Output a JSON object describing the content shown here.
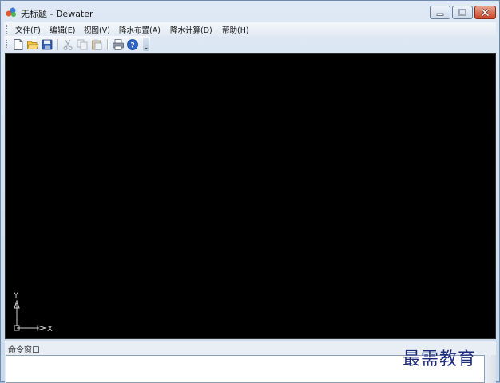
{
  "window": {
    "title": "无标题 - Dewater"
  },
  "menu": [
    {
      "label": "文件(F)"
    },
    {
      "label": "编辑(E)"
    },
    {
      "label": "视图(V)"
    },
    {
      "label": "降水布置(A)"
    },
    {
      "label": "降水计算(D)"
    },
    {
      "label": "帮助(H)"
    }
  ],
  "toolbar": {
    "icons": [
      "new-file-icon",
      "open-folder-icon",
      "save-icon",
      "cut-icon",
      "copy-icon",
      "paste-icon",
      "print-icon",
      "help-icon"
    ]
  },
  "canvas": {
    "background": "#000000",
    "axis": {
      "x_label": "X",
      "y_label": "Y",
      "color": "#d0d0d0"
    }
  },
  "command_window": {
    "title": "命令窗口"
  },
  "watermark": {
    "text": "最需教育"
  }
}
